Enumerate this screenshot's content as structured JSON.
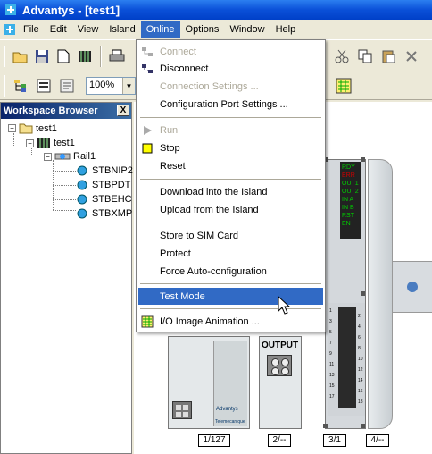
{
  "window": {
    "title": "Advantys - [test1]"
  },
  "menubar": {
    "items": [
      "File",
      "Edit",
      "View",
      "Island",
      "Online",
      "Options",
      "Window",
      "Help"
    ],
    "active": "Online"
  },
  "toolbar": {
    "zoom_value": "100%"
  },
  "workspace": {
    "title": "Workspace Browser",
    "close_label": "X",
    "tree": {
      "root": "test1",
      "island": "test1",
      "rail": "Rail1",
      "modules": [
        "STBNIP2",
        "STBPDT",
        "STBEHC",
        "STBXMP"
      ]
    }
  },
  "online_menu": {
    "items": [
      {
        "label": "Connect",
        "underline": "C",
        "rest": "onnect",
        "disabled": true,
        "icon": "connect-icon"
      },
      {
        "label": "Disconnect",
        "underline": "D",
        "rest": "isconnect",
        "disabled": false,
        "icon": "disconnect-icon"
      },
      {
        "label": "Connection Settings ...",
        "disabled": true
      },
      {
        "label": "Configuration Port Settings ...",
        "disabled": false
      },
      {
        "label": "Run",
        "disabled": true,
        "icon": "run-icon"
      },
      {
        "label": "Stop",
        "disabled": false,
        "icon": "stop-icon"
      },
      {
        "label": "Reset",
        "disabled": false
      },
      {
        "label": "Download into the Island",
        "disabled": false
      },
      {
        "label": "Upload from the Island",
        "disabled": false
      },
      {
        "label": "Store to SIM Card",
        "disabled": false
      },
      {
        "label": "Protect",
        "disabled": false
      },
      {
        "label": "Force Auto-configuration",
        "disabled": false
      },
      {
        "label": "Test Mode",
        "disabled": false,
        "highlight": true
      },
      {
        "label": "I/O Image Animation ...",
        "disabled": false,
        "icon": "io-animation-icon"
      }
    ]
  },
  "island_canvas": {
    "led_labels": [
      "RDY",
      "ERR",
      "OUT1",
      "OUT2",
      "IN A",
      "IN B",
      "RST",
      "EN"
    ],
    "output_label": "OUTPUT",
    "brand_labels": [
      "Advantys",
      "Telemecanique"
    ],
    "slot_labels": [
      "1/127",
      "2/--",
      "3/1",
      "4/--"
    ],
    "terminal_numbers": [
      "1",
      "2",
      "3",
      "4",
      "5",
      "6",
      "7",
      "8",
      "9",
      "10",
      "11",
      "12",
      "13",
      "14",
      "15",
      "16",
      "17",
      "18"
    ]
  },
  "colors": {
    "titlebar": "#0a50d8",
    "menu_highlight": "#316ac5",
    "stop_square": "#ffff00",
    "led_green": "#00cc00",
    "led_red": "#cc0000"
  }
}
